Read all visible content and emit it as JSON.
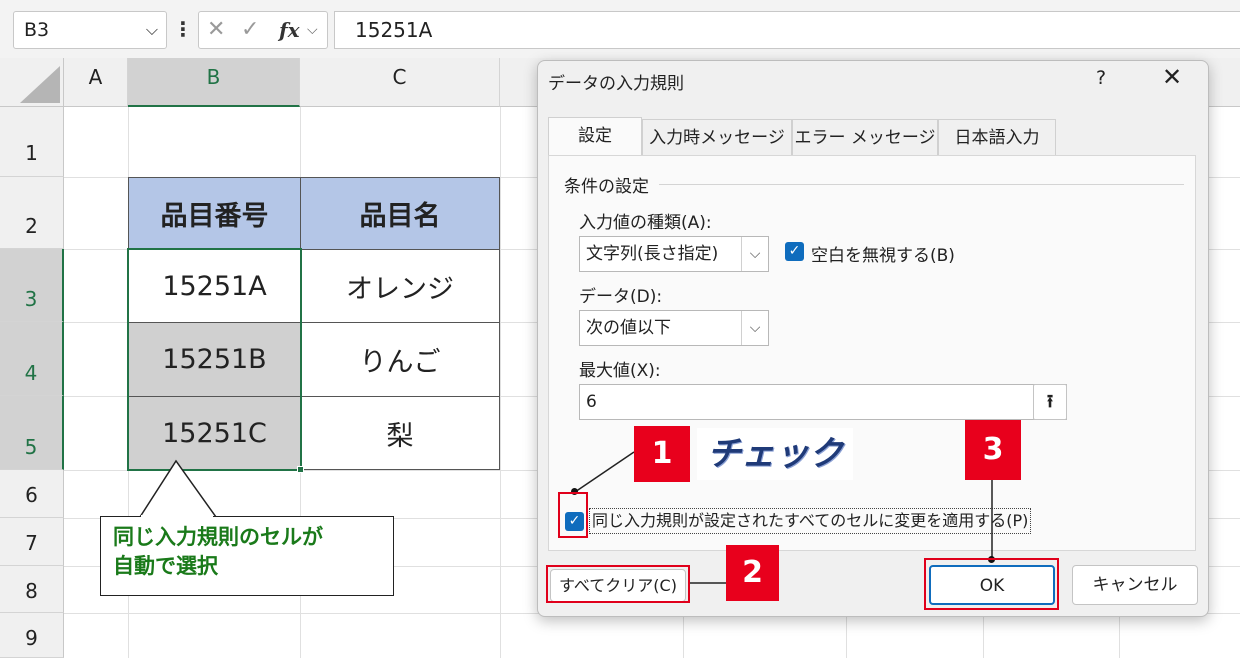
{
  "formula_bar": {
    "name_box": "B3",
    "formula": "15251A"
  },
  "grid": {
    "columns": [
      "A",
      "B",
      "C"
    ],
    "rows": [
      "1",
      "2",
      "3",
      "4",
      "5",
      "6",
      "7",
      "8",
      "9"
    ],
    "table_header": [
      "品目番号",
      "品目名"
    ],
    "table_rows": [
      [
        "15251A",
        "オレンジ"
      ],
      [
        "15251B",
        "りんご"
      ],
      [
        "15251C",
        "梨"
      ]
    ]
  },
  "callout": {
    "line1": "同じ入力規則のセルが",
    "line2": "自動で選択"
  },
  "dialog": {
    "title": "データの入力規則",
    "help": "?",
    "close": "✕",
    "tabs": [
      "設定",
      "入力時メッセージ",
      "エラー メッセージ",
      "日本語入力"
    ],
    "section_title": "条件の設定",
    "allow_label": "入力値の種類(A):",
    "allow_value": "文字列(長さ指定)",
    "ignore_blank_label": "空白を無視する(B)",
    "ignore_blank_checked": true,
    "data_label": "データ(D):",
    "data_value": "次の値以下",
    "max_label": "最大値(X):",
    "max_value": "6",
    "apply_all_label": "同じ入力規則が設定されたすべてのセルに変更を適用する(P)",
    "apply_all_checked": true,
    "clear_all_button": "すべてクリア(C)",
    "ok_button": "OK",
    "cancel_button": "キャンセル"
  },
  "annotations": {
    "step1": "1",
    "step1_label": "チェック",
    "step2": "2",
    "step3": "3"
  },
  "colors": {
    "accent_red": "#e8001c",
    "excel_green": "#217346",
    "header_blue": "#b4c6e7",
    "checkbox_blue": "#0f6cbd"
  }
}
